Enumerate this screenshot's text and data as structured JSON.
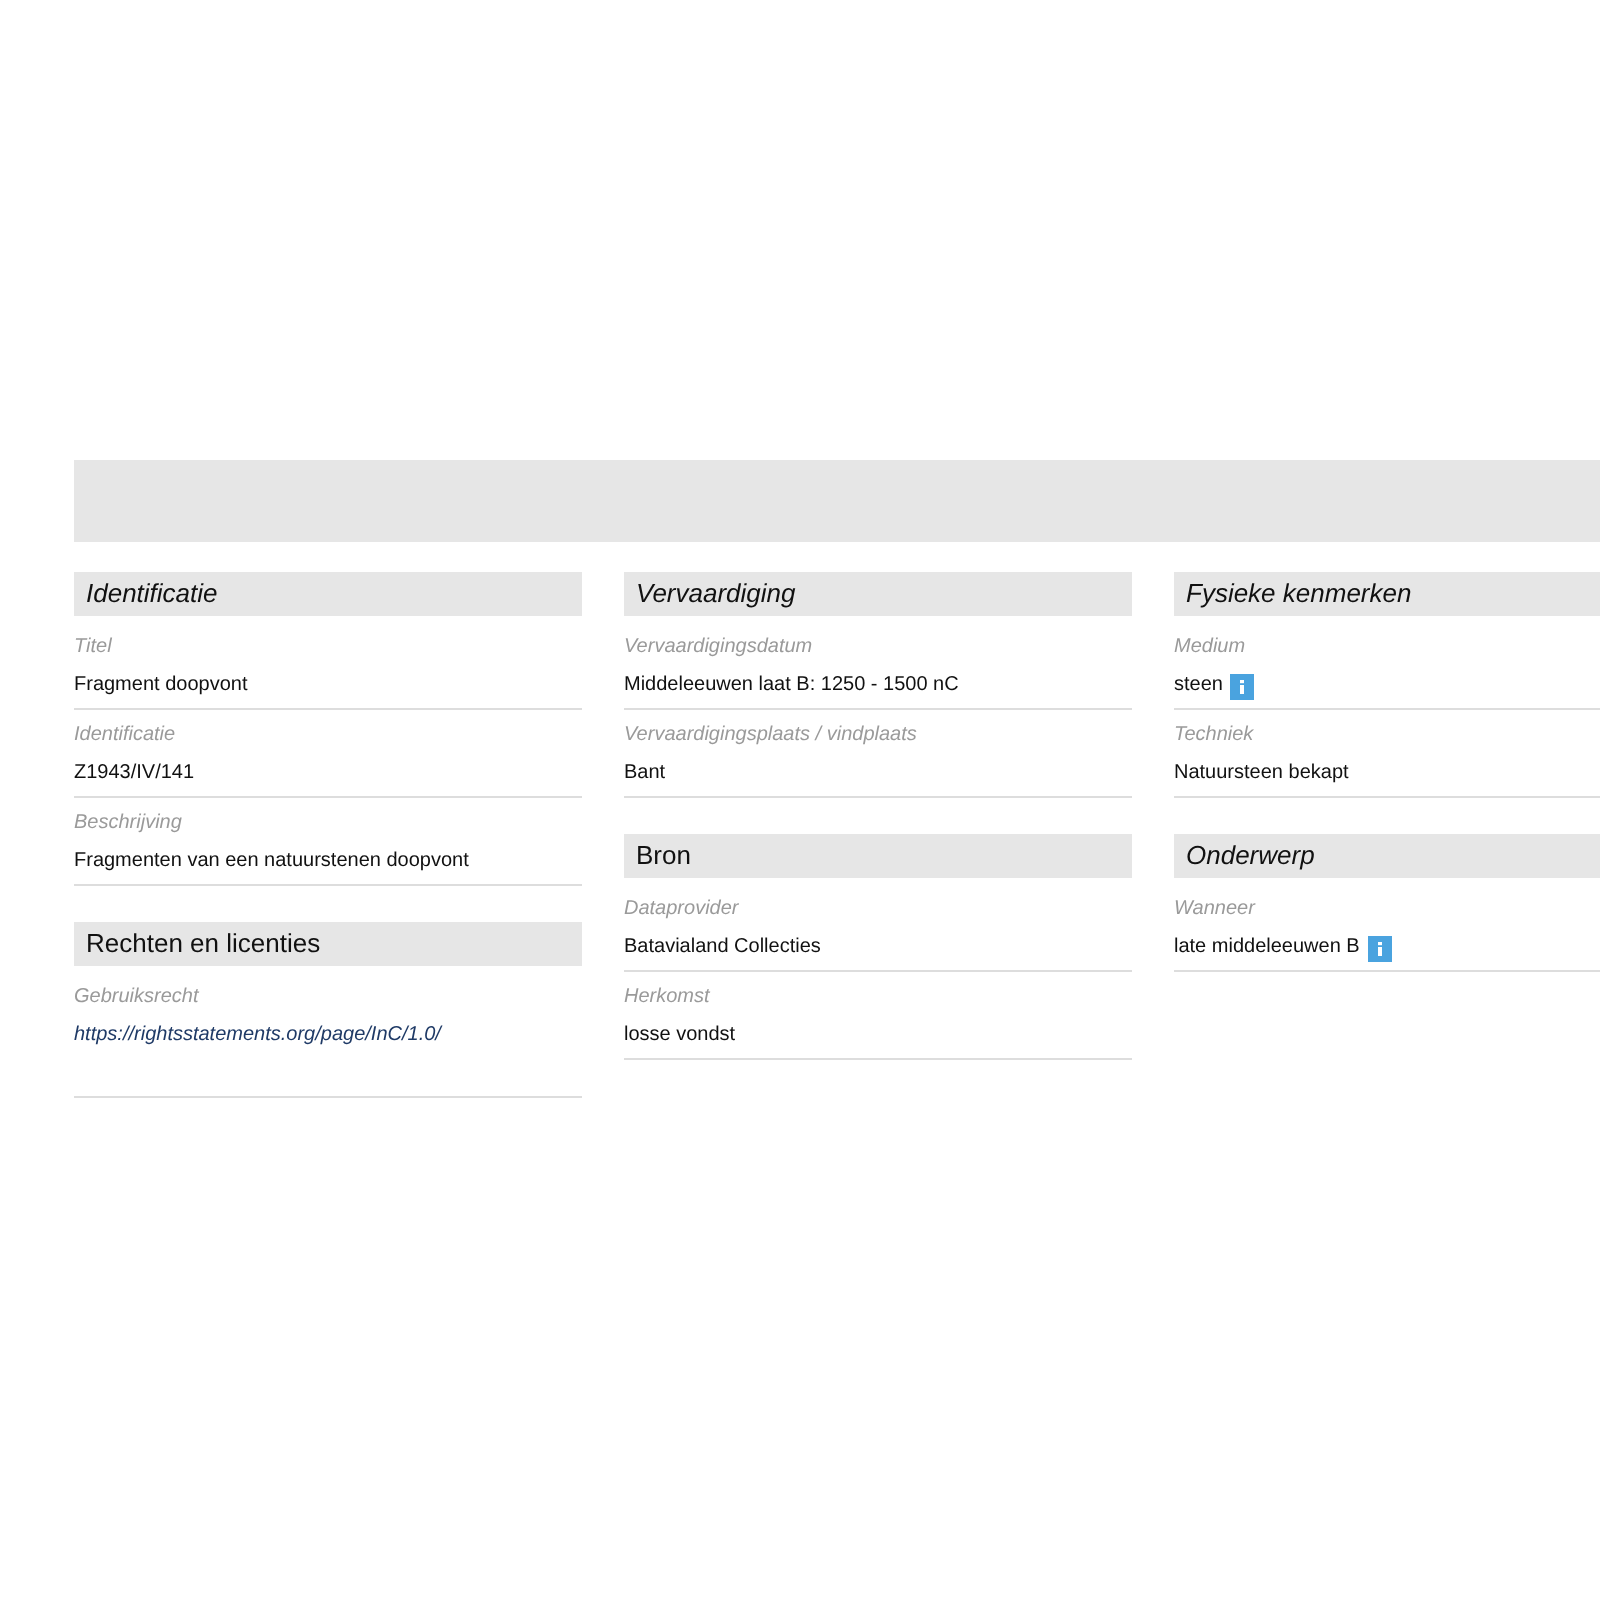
{
  "columns": [
    {
      "sections": [
        {
          "title": "Identificatie",
          "italic": true,
          "items": [
            {
              "label": "Titel",
              "value": "Fragment doopvont",
              "kind": "text",
              "info": false
            },
            {
              "label": "Identificatie",
              "value": "Z1943/IV/141",
              "kind": "text",
              "info": false
            },
            {
              "label": "Beschrijving",
              "value": "Fragmenten van een natuurstenen doopvont",
              "kind": "text",
              "info": false
            }
          ]
        },
        {
          "title": "Rechten en licenties",
          "italic": false,
          "items": [
            {
              "label": "Gebruiksrecht",
              "value": "https://rightsstatements.org/page/InC/1.0/",
              "kind": "link",
              "info": false
            }
          ]
        }
      ]
    },
    {
      "sections": [
        {
          "title": "Vervaardiging",
          "italic": true,
          "items": [
            {
              "label": "Vervaardigingsdatum",
              "value": "Middeleeuwen laat B: 1250 - 1500 nC",
              "kind": "text",
              "info": false
            },
            {
              "label": "Vervaardigingsplaats / vindplaats",
              "value": "Bant",
              "kind": "text",
              "info": false
            }
          ]
        },
        {
          "title": "Bron",
          "italic": false,
          "items": [
            {
              "label": "Dataprovider",
              "value": "Batavialand Collecties",
              "kind": "text",
              "info": false
            },
            {
              "label": "Herkomst",
              "value": "losse vondst",
              "kind": "text",
              "info": false
            }
          ]
        }
      ]
    },
    {
      "sections": [
        {
          "title": "Fysieke kenmerken",
          "italic": true,
          "items": [
            {
              "label": "Medium",
              "value": "steen",
              "kind": "text",
              "info": true
            },
            {
              "label": "Techniek",
              "value": "Natuursteen bekapt",
              "kind": "text",
              "info": false
            }
          ]
        },
        {
          "title": "Onderwerp",
          "italic": true,
          "items": [
            {
              "label": "Wanneer",
              "value": "late middeleeuwen B",
              "kind": "text",
              "info": true
            }
          ]
        }
      ]
    }
  ]
}
